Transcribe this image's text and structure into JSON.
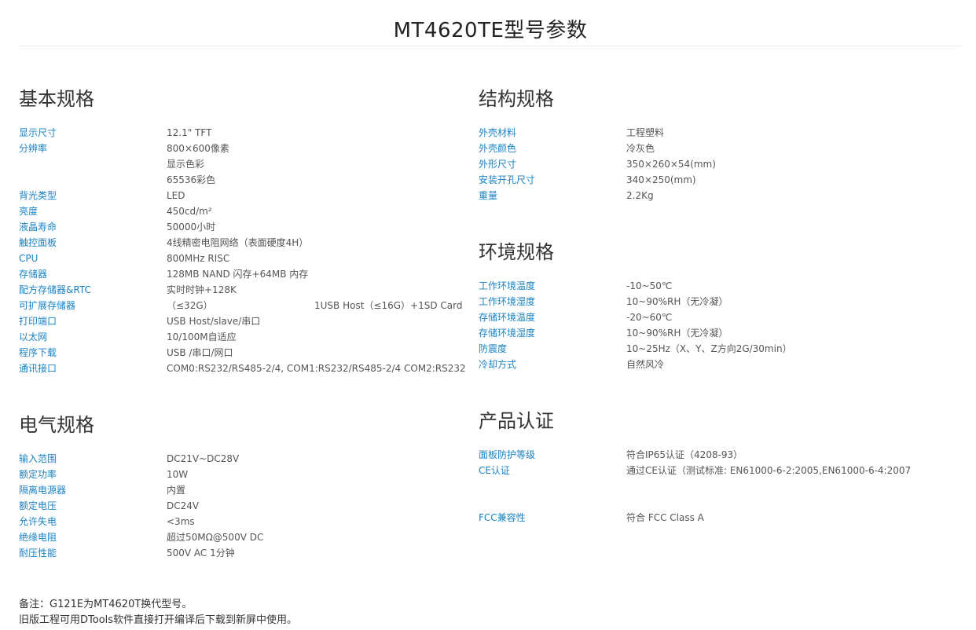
{
  "page_title": "MT4620TE型号参数",
  "basic": {
    "title": "基本规格",
    "rows": [
      {
        "k": "显示尺寸",
        "v": "12.1\" TFT"
      },
      {
        "k": "分辨率",
        "v": "800×600像素"
      },
      {
        "k": "",
        "v": "显示色彩"
      },
      {
        "k": "",
        "v": "65536彩色"
      },
      {
        "k": "背光类型",
        "v": "LED"
      },
      {
        "k": "亮度",
        "v": "450cd/m²"
      },
      {
        "k": "液晶寿命",
        "v": "50000小时"
      },
      {
        "k": "触控面板",
        "v": "4线精密电阻网络（表面硬度4H）"
      },
      {
        "k": "CPU",
        "v": "800MHz RISC"
      },
      {
        "k": "存储器",
        "v": "128MB NAND 闪存+64MB 内存"
      },
      {
        "k": "配方存储器&RTC",
        "v": "实时时钟+128K"
      },
      {
        "k": "可扩展存储器",
        "v": "（≤32G）",
        "v2": "1USB Host（≤16G）+1SD Card"
      },
      {
        "k": "打印端口",
        "v": "USB Host/slave/串口"
      },
      {
        "k": "以太网",
        "v": "10/100M自适应"
      },
      {
        "k": "程序下载",
        "v": "USB /串口/网口"
      },
      {
        "k": "通讯接口",
        "v": "COM0:RS232/RS485-2/4, COM1:RS232/RS485-2/4 COM2:RS232"
      }
    ]
  },
  "electric": {
    "title": "电气规格",
    "rows": [
      {
        "k": "输入范围",
        "v": "DC21V~DC28V"
      },
      {
        "k": "额定功率",
        "v": "10W"
      },
      {
        "k": "隔离电源器",
        "v": "内置"
      },
      {
        "k": "额定电压",
        "v": "DC24V"
      },
      {
        "k": "允许失电",
        "v": "<3ms"
      },
      {
        "k": "绝缘电阻",
        "v": "超过50MΩ@500V DC"
      },
      {
        "k": "耐压性能",
        "v": "500V AC 1分钟"
      }
    ]
  },
  "structure": {
    "title": "结构规格",
    "rows": [
      {
        "k": "外壳材料",
        "v": "工程塑料"
      },
      {
        "k": "外壳颜色",
        "v": "冷灰色"
      },
      {
        "k": "外形尺寸",
        "v": "350×260×54(mm)"
      },
      {
        "k": "安装开孔尺寸",
        "v": "340×250(mm)"
      },
      {
        "k": "重量",
        "v": "2.2Kg"
      }
    ]
  },
  "environment": {
    "title": "环境规格",
    "rows": [
      {
        "k": "工作环境温度",
        "v": "-10~50℃"
      },
      {
        "k": "工作环境湿度",
        "v": "10~90%RH（无冷凝）"
      },
      {
        "k": "存储环境温度",
        "v": "-20~60℃"
      },
      {
        "k": "存储环境湿度",
        "v": "10~90%RH（无冷凝）"
      },
      {
        "k": "防震度",
        "v": "10~25Hz（X、Y、Z方向2G/30min）"
      },
      {
        "k": "冷却方式",
        "v": "自然风冷"
      }
    ]
  },
  "certification": {
    "title": "产品认证",
    "rows": [
      {
        "k": "面板防护等级",
        "v": "符合IP65认证（4208-93）"
      },
      {
        "k": "CE认证",
        "v": "通过CE认证（测试标准: EN61000-6-2:2005,EN61000-6-4:2007"
      },
      {
        "k": "",
        "v": ""
      },
      {
        "k": "",
        "v": ""
      },
      {
        "k": "FCC兼容性",
        "v": "符合 FCC Class A"
      }
    ]
  },
  "notes": [
    "备注：G121E为MT4620T换代型号。",
    "旧版工程可用DTools软件直接打开编译后下载到新屏中使用。"
  ],
  "colors": {
    "key": "#1a82c4",
    "value": "#555555",
    "heading": "#333333"
  }
}
